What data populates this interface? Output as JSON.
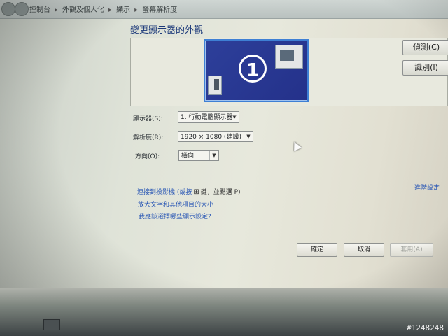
{
  "breadcrumb": [
    "控制台",
    "外觀及個人化",
    "顯示",
    "螢幕解析度"
  ],
  "page_title": "變更顯示器的外觀",
  "preview": {
    "monitor_number": "1"
  },
  "buttons": {
    "detect": "偵測(C)",
    "identify": "識別(I)"
  },
  "form": {
    "display_label": "顯示器(S):",
    "display_value": "1. 行動電腦顯示器",
    "resolution_label": "解析度(R):",
    "resolution_value": "1920 × 1080 (建議)",
    "orientation_label": "方向(O):",
    "orientation_value": "橫向"
  },
  "links": {
    "advanced": "進階設定",
    "projector_prefix": "連接到投影機 (或按",
    "projector_suffix": "鍵，並點選 P)",
    "text_size": "放大文字和其他項目的大小",
    "help": "我應該選擇哪些顯示設定?"
  },
  "dialog_buttons": {
    "ok": "確定",
    "cancel": "取消",
    "apply": "套用(A)"
  },
  "watermark": "#1248248"
}
